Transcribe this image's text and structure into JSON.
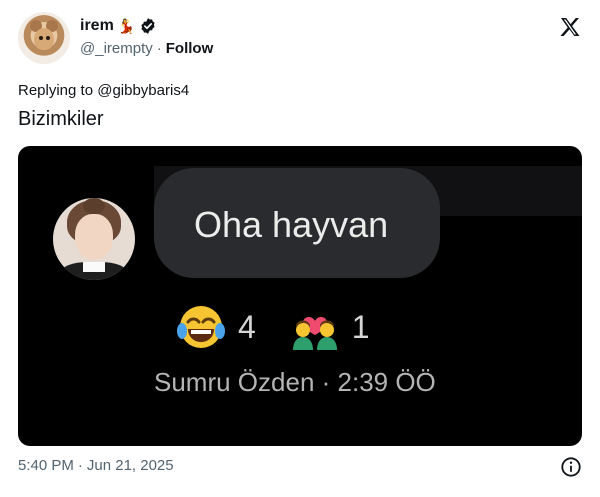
{
  "tweet": {
    "author": {
      "display_name": "irem",
      "name_emoji": "💃",
      "verified_icon": "verified-badge-icon",
      "handle": "@_irempty",
      "separator": "·",
      "follow_label": "Follow"
    },
    "platform_icon": "x-logo-icon",
    "replying": {
      "prefix": "Replying to",
      "handle": "@gibbybaris4"
    },
    "text": "Bizimkiler",
    "timestamp": {
      "time": "5:40 PM",
      "separator": "·",
      "date": "Jun 21, 2025"
    },
    "info_icon": "info-icon"
  },
  "media": {
    "message_text": "Oha hayvan",
    "reactions": [
      {
        "icon": "face-with-tears-of-joy-icon",
        "count": "4"
      },
      {
        "icon": "couple-with-heart-icon",
        "count": "1"
      }
    ],
    "sender_line": "Sumru Özden · 2:39 ÖÖ"
  },
  "colors": {
    "text_primary": "#0f1419",
    "text_secondary": "#536471",
    "media_bg": "#000000",
    "bubble_bg": "#2a2b2e"
  }
}
